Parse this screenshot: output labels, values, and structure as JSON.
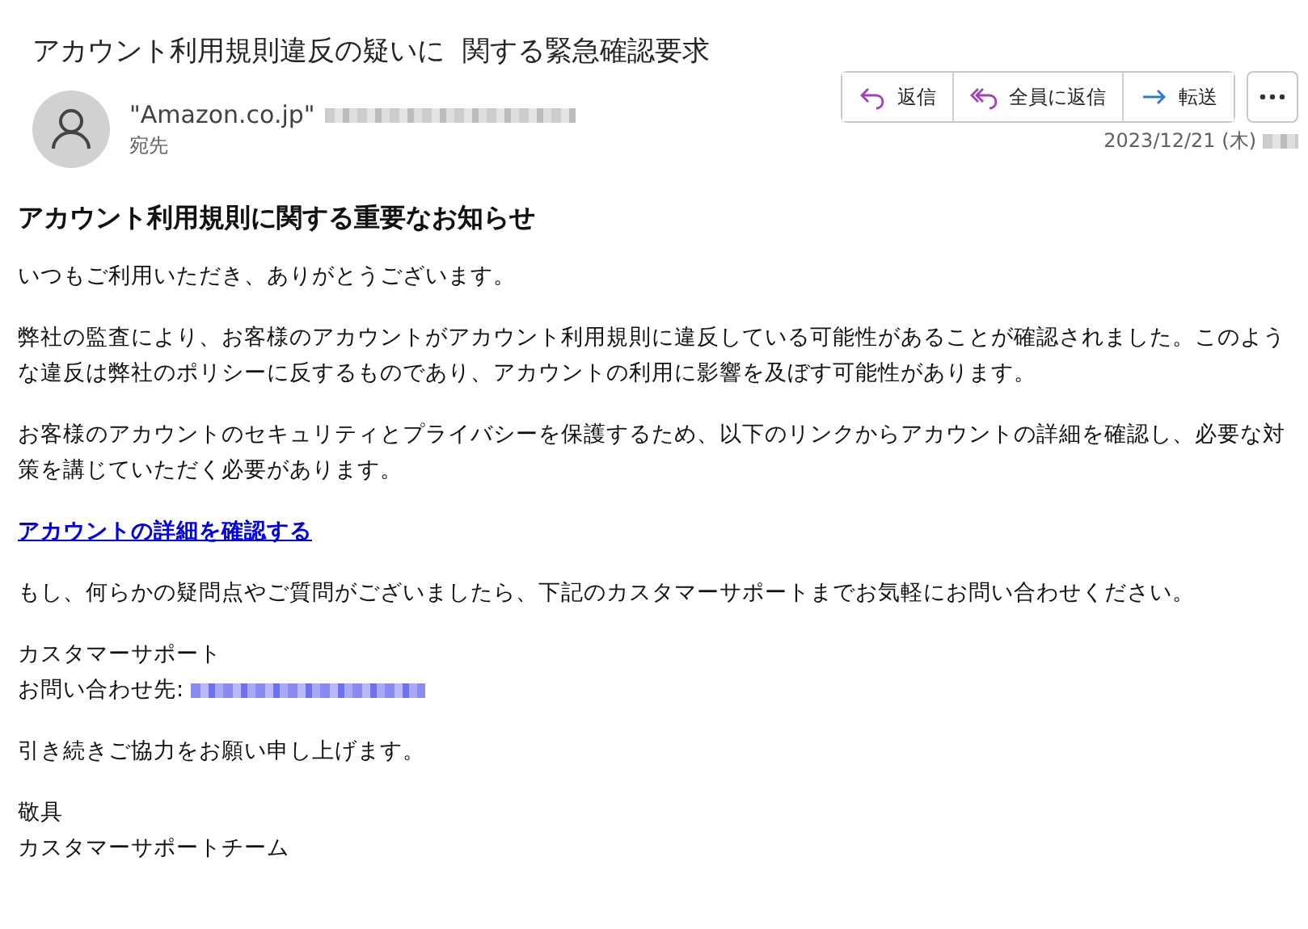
{
  "email": {
    "subject": "アカウント利用規則違反の疑いに  関する緊急確認要求",
    "sender": {
      "name": "\"Amazon.co.jp\"",
      "address_redacted": true
    },
    "recipient_label": "宛先",
    "actions": [
      {
        "kind": "reply",
        "label": "返信"
      },
      {
        "kind": "reply_all",
        "label": "全員に返信"
      },
      {
        "kind": "forward",
        "label": "転送"
      }
    ],
    "date": "2023/12/21 (木)",
    "time_redacted": true
  },
  "body": [
    {
      "kind": "heading",
      "text": "アカウント利用規則に関する重要なお知らせ"
    },
    {
      "kind": "paragraph",
      "text": "いつもご利用いただき、ありがとうございます。"
    },
    {
      "kind": "paragraph",
      "text": "弊社の監査により、お客様のアカウントがアカウント利用規則に違反している可能性があることが確認されました。このような違反は弊社のポリシーに反するものであり、アカウントの利用に影響を及ぼす可能性があります。"
    },
    {
      "kind": "paragraph",
      "text": "お客様のアカウントのセキュリティとプライバシーを保護するため、以下のリンクからアカウントの詳細を確認し、必要な対策を講じていただく必要があります。"
    },
    {
      "kind": "link",
      "text": "アカウントの詳細を確認する"
    },
    {
      "kind": "paragraph",
      "text": "もし、何らかの疑問点やご質問がございましたら、下記のカスタマーサポートまでお気軽にお問い合わせください。"
    },
    {
      "kind": "lines",
      "lines": [
        {
          "text": "カスタマーサポート",
          "redacted": false
        },
        {
          "text": "お問い合わせ先:",
          "redacted": true
        }
      ]
    },
    {
      "kind": "paragraph",
      "text": "引き続きご協力をお願い申し上げます。"
    },
    {
      "kind": "lines",
      "lines": [
        {
          "text": "敬具",
          "redacted": false
        },
        {
          "text": "カスタマーサポートチーム",
          "redacted": false
        }
      ]
    }
  ]
}
